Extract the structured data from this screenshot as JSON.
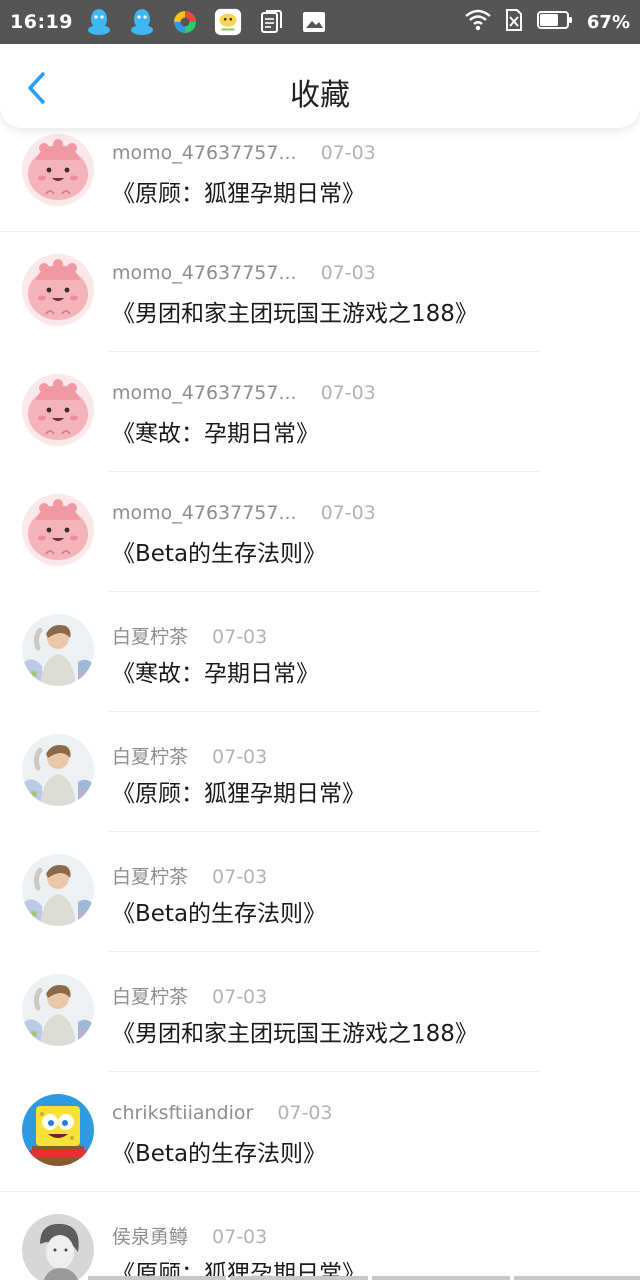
{
  "status_bar": {
    "time": "16:19",
    "battery_pct": "67%",
    "icons_left": [
      "qq-icon",
      "qq-icon",
      "app-icon",
      "chat-app-icon",
      "document-icon",
      "gallery-icon"
    ],
    "icons_right": [
      "wifi-icon",
      "no-sim-icon",
      "battery-icon"
    ]
  },
  "header": {
    "title": "收藏",
    "accent_color": "#2a9df4"
  },
  "items": [
    {
      "username": "momo_47637757...",
      "date": "07-03",
      "title": "《原顾：狐狸孕期日常》",
      "avatar": "pink-blob"
    },
    {
      "username": "momo_47637757...",
      "date": "07-03",
      "title": "《男团和家主团玩国王游戏之188》",
      "avatar": "pink-blob"
    },
    {
      "username": "momo_47637757...",
      "date": "07-03",
      "title": "《寒故：孕期日常》",
      "avatar": "pink-blob"
    },
    {
      "username": "momo_47637757...",
      "date": "07-03",
      "title": "《Beta的生存法则》",
      "avatar": "pink-blob"
    },
    {
      "username": "白夏柠茶",
      "date": "07-03",
      "title": "《寒故：孕期日常》",
      "avatar": "boy-photo"
    },
    {
      "username": "白夏柠茶",
      "date": "07-03",
      "title": "《原顾：狐狸孕期日常》",
      "avatar": "boy-photo"
    },
    {
      "username": "白夏柠茶",
      "date": "07-03",
      "title": "《Beta的生存法则》",
      "avatar": "boy-photo"
    },
    {
      "username": "白夏柠茶",
      "date": "07-03",
      "title": "《男团和家主团玩国王游戏之188》",
      "avatar": "boy-photo"
    },
    {
      "username": "chriksftiiandior",
      "date": "07-03",
      "title": "《Beta的生存法则》",
      "avatar": "sponge-cartoon"
    },
    {
      "username": "侯泉勇鳟",
      "date": "07-03",
      "title": "《原顾：狐狸孕期日常》",
      "avatar": "gray-portrait"
    }
  ]
}
